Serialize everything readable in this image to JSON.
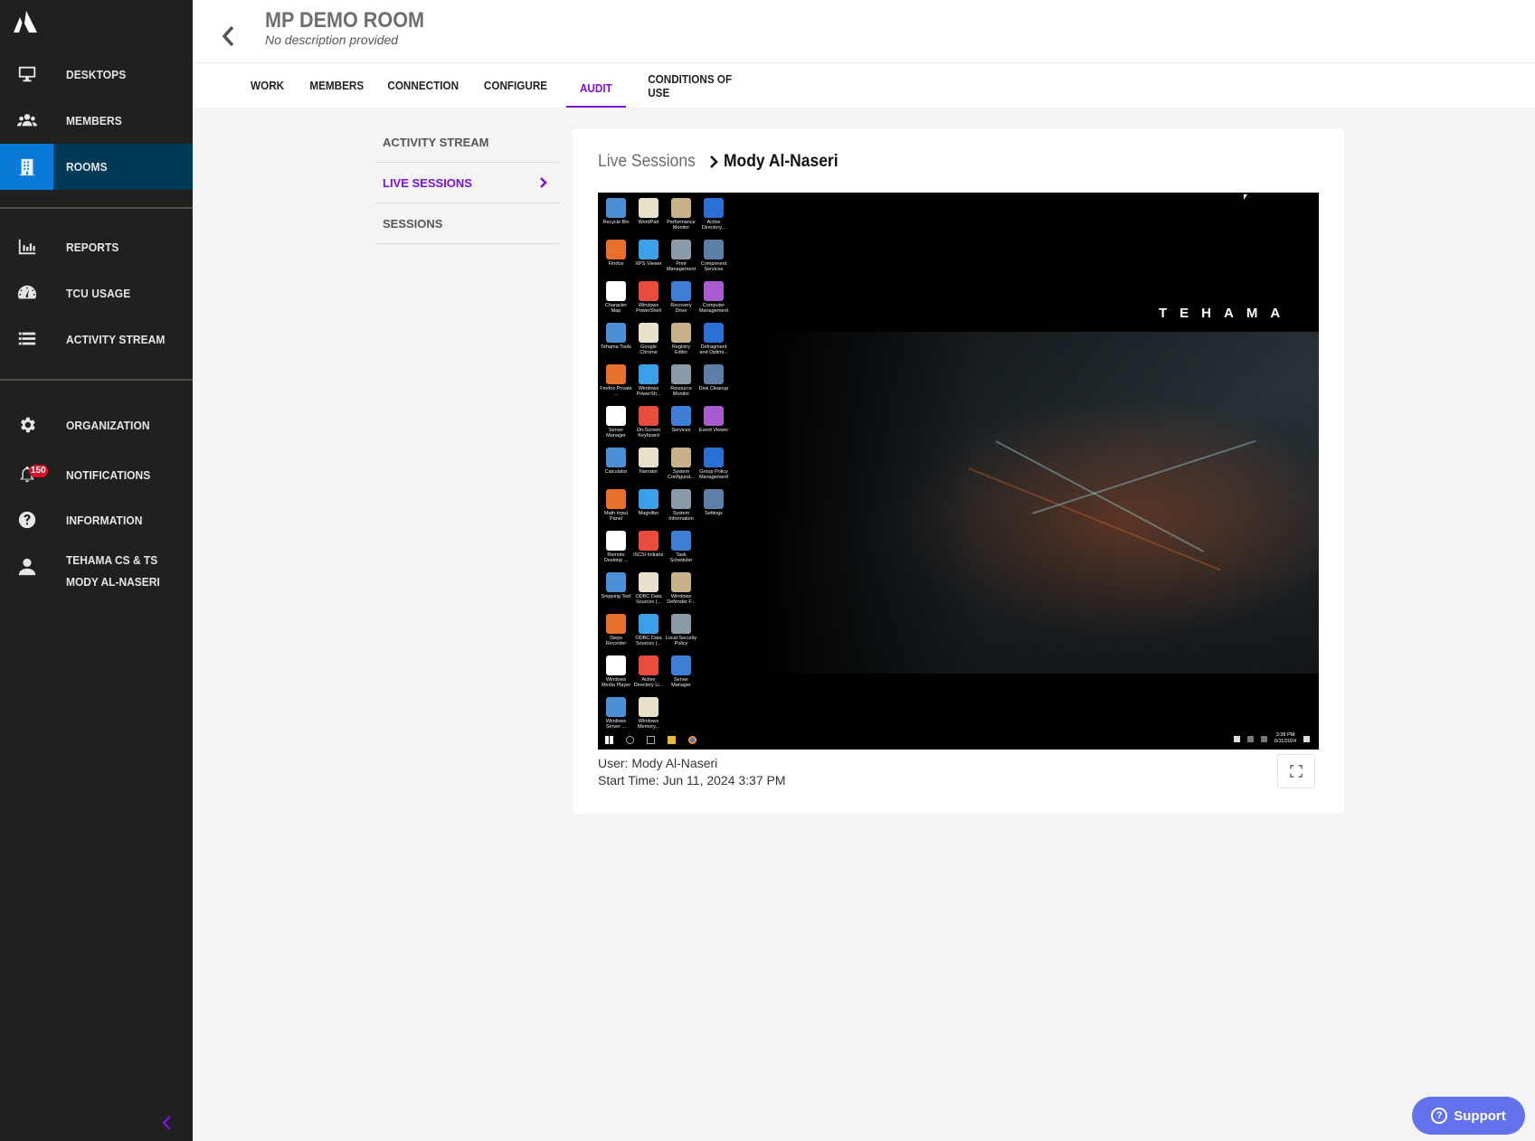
{
  "sidebar": {
    "items": [
      {
        "id": "desktops",
        "label": "DESKTOPS",
        "icon": "monitor-icon"
      },
      {
        "id": "members",
        "label": "MEMBERS",
        "icon": "users-icon"
      },
      {
        "id": "rooms",
        "label": "ROOMS",
        "icon": "building-icon",
        "active": true
      },
      {
        "id": "reports",
        "label": "REPORTS",
        "icon": "bar-chart-icon"
      },
      {
        "id": "tcu-usage",
        "label": "TCU USAGE",
        "icon": "gauge-icon"
      },
      {
        "id": "activity-stream",
        "label": "ACTIVITY STREAM",
        "icon": "list-icon"
      },
      {
        "id": "organization",
        "label": "ORGANIZATION",
        "icon": "gear-icon"
      },
      {
        "id": "notifications",
        "label": "NOTIFICATIONS",
        "icon": "bell-icon",
        "badge": "150"
      },
      {
        "id": "information",
        "label": "INFORMATION",
        "icon": "help-circle-icon"
      }
    ],
    "user": {
      "org": "TEHAMA CS & TS",
      "name": "MODY AL-NASERI",
      "icon": "user-icon"
    },
    "colors": {
      "background": "#20201e",
      "active_bg": "#003a57",
      "active_icon_bg": "#0a7ad8",
      "accent": "#7b10d8"
    }
  },
  "header": {
    "title": "MP DEMO ROOM",
    "description": "No description provided"
  },
  "tabs": [
    {
      "label": "WORK"
    },
    {
      "label": "MEMBERS"
    },
    {
      "label": "CONNECTION"
    },
    {
      "label": "CONFIGURE"
    },
    {
      "label": "AUDIT",
      "active": true
    },
    {
      "label": "CONDITIONS OF USE"
    }
  ],
  "subnav": [
    {
      "label": "ACTIVITY STREAM"
    },
    {
      "label": "LIVE SESSIONS",
      "active": true
    },
    {
      "label": "SESSIONS"
    }
  ],
  "session": {
    "breadcrumb_parent": "Live Sessions",
    "breadcrumb_current": "Mody Al-Naseri",
    "user_line": "User: Mody Al-Naseri",
    "start_line": "Start Time: Jun 11, 2024 3:37 PM",
    "remote_screen": {
      "brand": "TEHAMA",
      "desktop_icons": [
        "Recycle Bin",
        "WordPad",
        "Performance Monitor",
        "Active Directory...",
        "Firefox",
        "XPS Viewer",
        "Print Management",
        "Component Services",
        "Character Map",
        "Windows PowerShell",
        "Recovery Drive",
        "Computer Management",
        "Tehama Tools",
        "Google Chrome",
        "Registry Editor",
        "Defragment and Optimi...",
        "Firefox Private ...",
        "Windows PowerSh...",
        "Resource Monitor",
        "Disk Cleanup",
        "Server Manager",
        "On-Screen Keyboard",
        "Services",
        "Event Viewer",
        "Calculator",
        "Narrator",
        "System Configurat...",
        "Group Policy Management",
        "Math Input Panel",
        "Magnifier",
        "System Information",
        "Settings",
        "Remote Desktop ...",
        "iSCSI Initiator",
        "Task Scheduler",
        "",
        "Snipping Tool",
        "ODBC Data Sources (...",
        "Windows Defender F...",
        "",
        "Steps Recorder",
        "ODBC Data Sources (...",
        "Local Security Policy",
        "",
        "Windows Media Player",
        "Active Directory Li...",
        "Server Manager",
        "",
        "Windows Server ...",
        "Windows Memory...",
        "",
        ""
      ],
      "taskbar_time": "3:38 PM",
      "taskbar_date": "6/11/2024"
    }
  },
  "support": {
    "label": "Support",
    "color": "#6372ec"
  }
}
